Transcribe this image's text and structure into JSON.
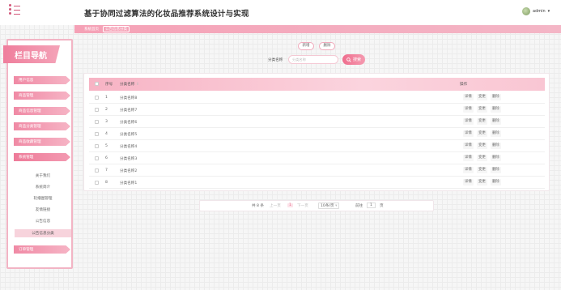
{
  "header": {
    "title": "基于协同过滤算法的化妆品推荐系统设计与实现",
    "username": "admin"
  },
  "breadcrumb": [
    "系统首页",
    "公告信息分类"
  ],
  "sidebar": {
    "heading": "栏目导航",
    "items": [
      {
        "label": "用户信息"
      },
      {
        "label": "商品管理"
      },
      {
        "label": "商品信息管理"
      },
      {
        "label": "商品分类管理"
      },
      {
        "label": "商品收藏管理"
      },
      {
        "label": "系统管理",
        "open": true
      }
    ],
    "sub_items": [
      {
        "label": "关于我们"
      },
      {
        "label": "系统简介"
      },
      {
        "label": "轮播图管理"
      },
      {
        "label": "友情链接"
      },
      {
        "label": "公告信息"
      },
      {
        "label": "公告信息分类",
        "active": true
      }
    ],
    "bottom_item": {
      "label": "订单管理"
    }
  },
  "toolbar": {
    "add_label": "新增",
    "delete_label": "删除",
    "search_label": "分类名称",
    "search_placeholder": "分类名称",
    "search_button": "搜索"
  },
  "table": {
    "columns": [
      "序号",
      "分类名称",
      "操作"
    ],
    "sort_indicator": "⇕",
    "rows": [
      {
        "index": "1",
        "name": "分类名称8"
      },
      {
        "index": "2",
        "name": "分类名称7"
      },
      {
        "index": "3",
        "name": "分类名称6"
      },
      {
        "index": "4",
        "name": "分类名称5"
      },
      {
        "index": "5",
        "name": "分类名称4"
      },
      {
        "index": "6",
        "name": "分类名称3"
      },
      {
        "index": "7",
        "name": "分类名称2"
      },
      {
        "index": "8",
        "name": "分类名称1"
      }
    ],
    "actions": [
      "详情",
      "变更",
      "删除"
    ]
  },
  "pagination": {
    "total": "共 8 条",
    "prev": "上一页",
    "current": "1",
    "next": "下一页",
    "page_size": "10条/页",
    "goto_label": "前往",
    "goto_value": "1",
    "page_suffix": "页"
  },
  "colors": {
    "accent": "#ef7e9c",
    "accent_light": "#f7b3c4"
  }
}
